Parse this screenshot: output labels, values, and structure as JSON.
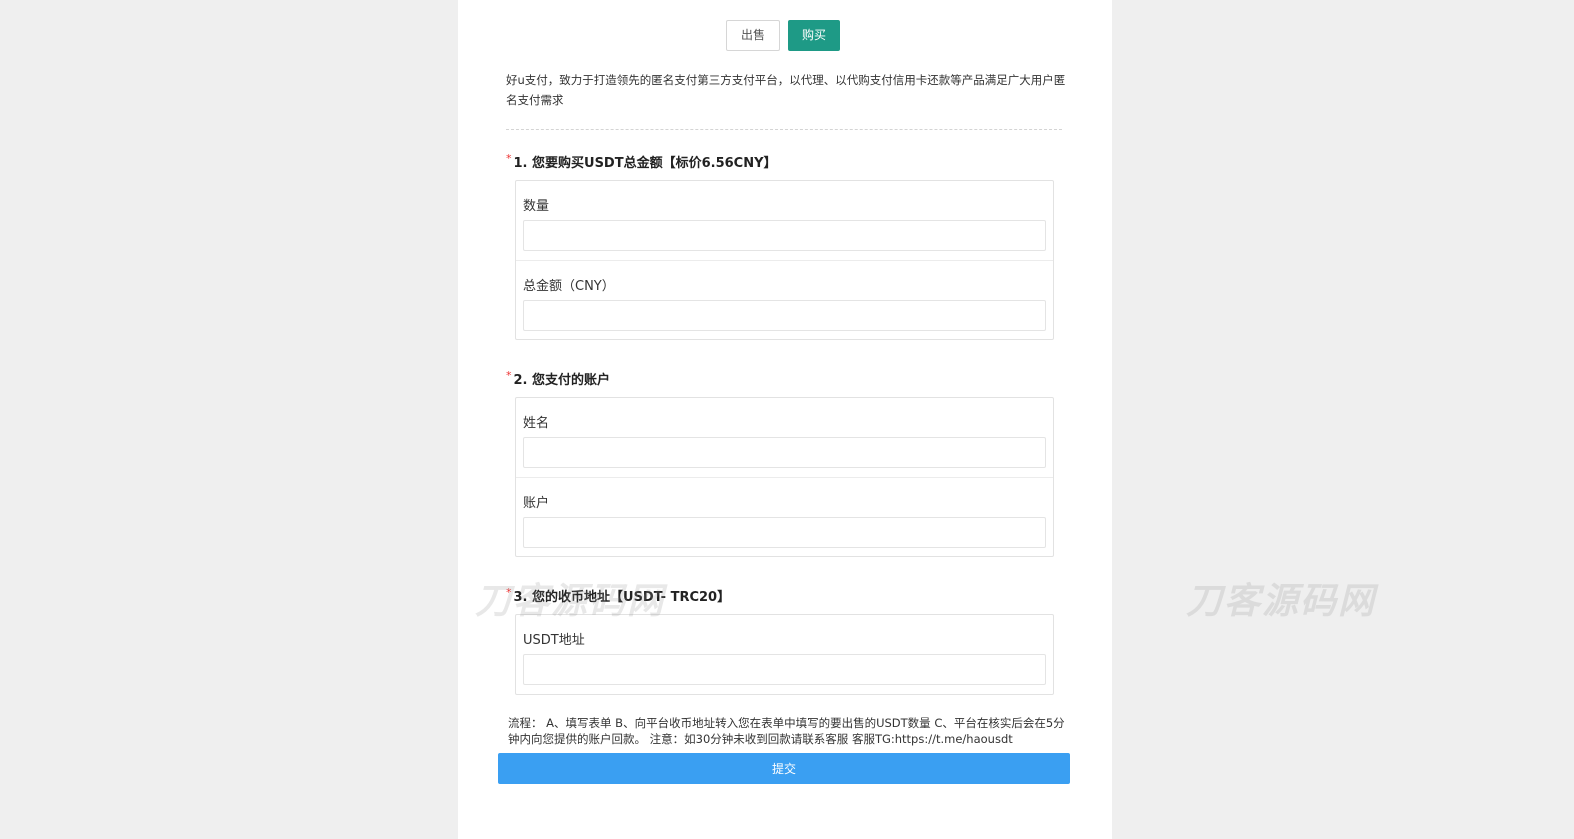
{
  "tabs": {
    "sell": "出售",
    "buy": "购买"
  },
  "intro": "好u支付，致力于打造领先的匿名支付第三方支付平台，以代理、以代购支付信用卡还款等产品满足广大用户匿名支付需求",
  "questions": [
    {
      "star": "*",
      "title": "1. 您要购买USDT总金额【标价6.56CNY】",
      "fields": [
        {
          "label": "数量",
          "value": ""
        },
        {
          "label": "总金额（CNY）",
          "value": ""
        }
      ]
    },
    {
      "star": "*",
      "title": "2. 您支付的账户",
      "fields": [
        {
          "label": "姓名",
          "value": ""
        },
        {
          "label": "账户",
          "value": ""
        }
      ]
    },
    {
      "star": "*",
      "title": "3. 您的收币地址【USDT- TRC20】",
      "fields": [
        {
          "label": "USDT地址",
          "value": ""
        }
      ]
    }
  ],
  "process": "流程： A、填写表单 B、向平台收币地址转入您在表单中填写的要出售的USDT数量 C、平台在核实后会在5分钟内向您提供的账户回款。 注意：如30分钟未收到回款请联系客服 客服TG:https://t.me/haousdt",
  "submit_label": "提交",
  "watermark": "刀客源码网",
  "colors": {
    "buy_tab": "#1e9a86",
    "submit": "#3a9ff2",
    "required_star": "#e33333"
  }
}
